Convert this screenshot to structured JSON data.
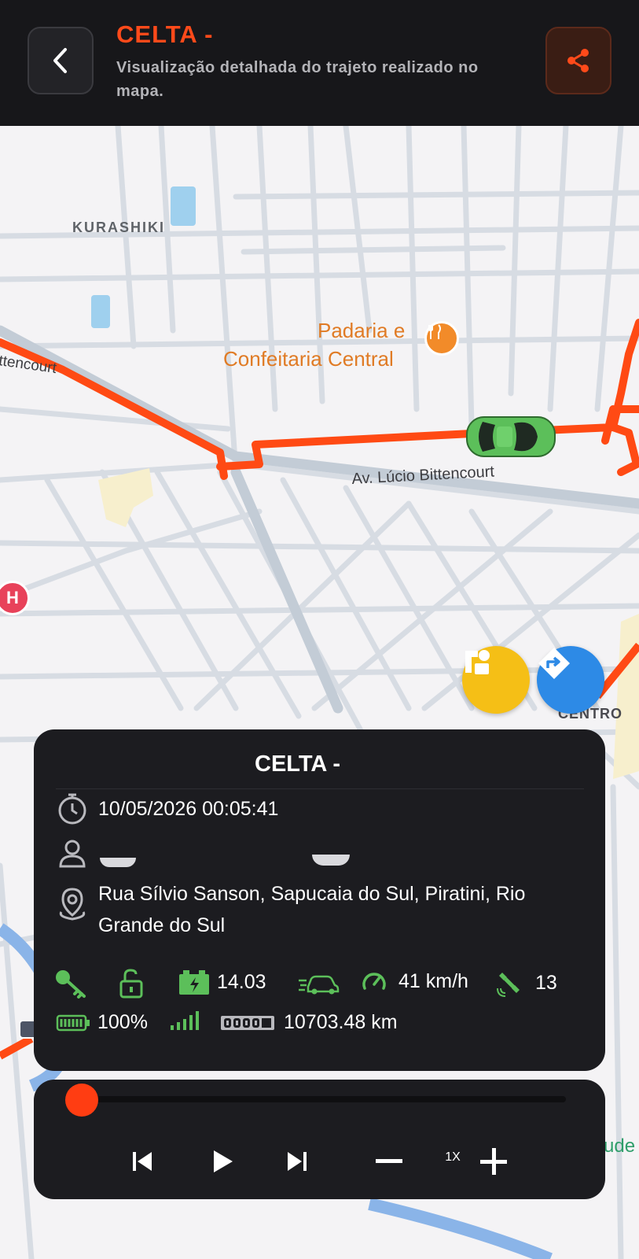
{
  "header": {
    "title": "CELTA -",
    "subtitle": "Visualização detalhada do trajeto realizado no mapa.",
    "back_icon": "chevron-left-icon",
    "share_icon": "share-icon"
  },
  "map": {
    "labels": {
      "kurashiki": "KURASHIKI",
      "bittencourt_left": "ttencourt",
      "padaria_line1": "Padaria e",
      "padaria_line2": "Confeitaria Central",
      "avenida": "Av. Lúcio Bittencourt",
      "centro": "CENTRO",
      "ude": "ude"
    },
    "colors": {
      "route": "#ff4a14",
      "car": "#5cbf5a",
      "poi": "#f28b29"
    }
  },
  "fabs": {
    "street_view_icon": "shapes-icon",
    "directions_icon": "directions-icon"
  },
  "info": {
    "vehicle": "CELTA -",
    "datetime": "10/05/2026 00:05:41",
    "address": "Rua Sílvio Sanson, Sapucaia do Sul, Piratini, Rio Grande do Sul",
    "voltage": "14.03",
    "speed": "41 km/h",
    "satellites": "13",
    "battery": "100%",
    "odometer": "10703.48 km",
    "accent_color": "#5cbf5a"
  },
  "player": {
    "progress": 0,
    "speed_label": "1X"
  }
}
